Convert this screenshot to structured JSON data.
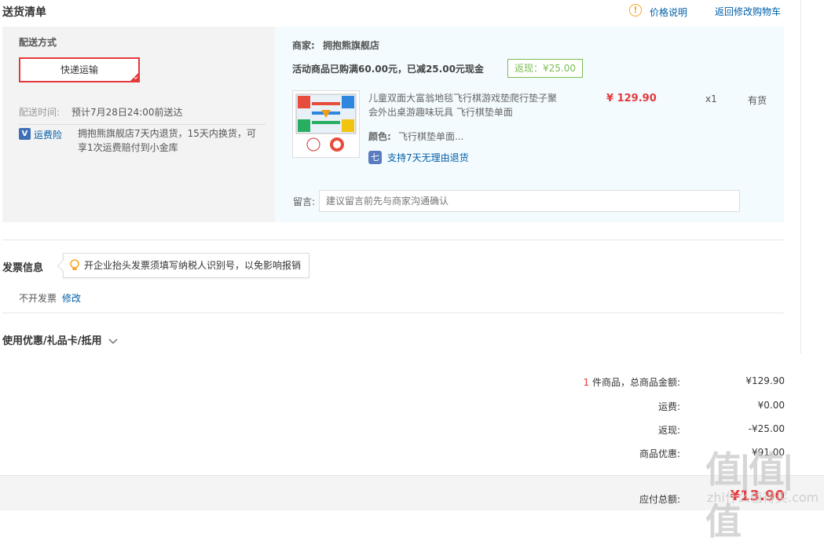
{
  "section": {
    "delivery_title": "送货清单",
    "price_note": "价格说明",
    "back_to_cart": "返回修改购物车"
  },
  "shipping": {
    "method_label": "配送方式",
    "method_value": "快递运输",
    "time_label": "配送时间:",
    "time_value": "预计7月28日24:00前送达",
    "insurance_label": "运费险",
    "insurance_desc_line1": "拥抱熊旗舰店7天内退货，15天内换货，可",
    "insurance_desc_line2": "享1次运费赔付到小金库"
  },
  "shop": {
    "merchant_label": "商家:",
    "merchant_name": "拥抱熊旗舰店",
    "promo_text": "活动商品已购满60.00元，已减25.00元现金",
    "cashback_badge": "返现：¥25.00"
  },
  "product": {
    "title_line1": "儿童双面大富翁地毯飞行棋游戏垫爬行垫子聚",
    "title_line2": "会外出桌游趣味玩具 飞行棋垫单面",
    "price": "¥ 129.90",
    "quantity": "x1",
    "stock": "有货",
    "color_label": "颜色:",
    "color_value": "飞行棋垫单面...",
    "return_policy": "支持7天无理由退货"
  },
  "remark": {
    "label": "留言:",
    "placeholder": "建议留言前先与商家沟通确认"
  },
  "invoice": {
    "title": "发票信息",
    "tip": "开企业抬头发票须填写纳税人识别号，以免影响报销",
    "value": "不开发票",
    "edit": "修改"
  },
  "coupon": {
    "title": "使用优惠/礼品卡/抵用"
  },
  "summary": {
    "count": "1",
    "count_suffix": "件商品，总商品金额:",
    "total_goods": "¥129.90",
    "shipping_label": "运费:",
    "shipping_value": "¥0.00",
    "cashback_label": "返现:",
    "cashback_value": "-¥25.00",
    "discount_label": "商品优惠:",
    "discount_value": "¥91.00",
    "payable_label": "应付总额:",
    "payable_value": "¥13.90"
  },
  "watermark": {
    "text": "值|值|值",
    "url": "zhi什么值得买.com"
  },
  "colors": {
    "accent_red": "#e4393c",
    "link_blue": "#005ea7",
    "cashback_green": "#7abd54"
  }
}
